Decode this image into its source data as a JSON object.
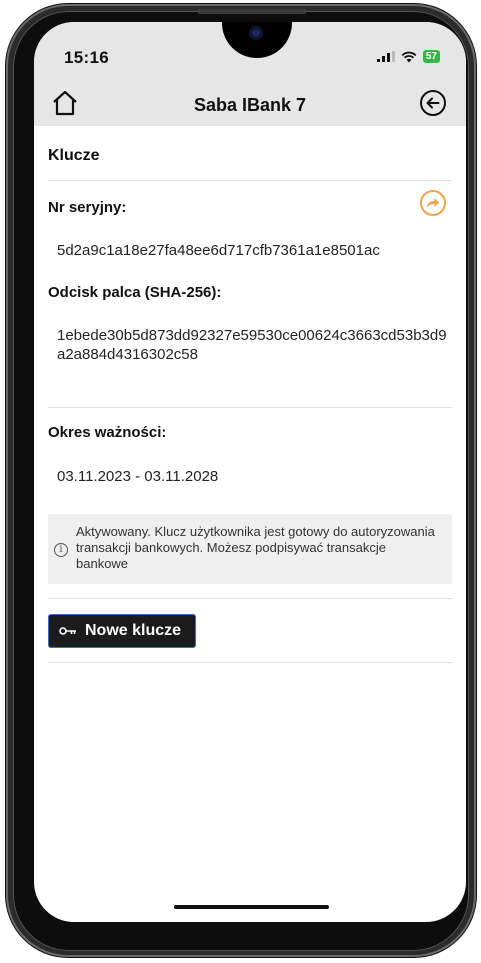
{
  "status_bar": {
    "time": "15:16",
    "battery": "57"
  },
  "app_bar": {
    "title": "Saba IBank 7",
    "home_icon": "home-icon",
    "back_icon": "back-arrow-circle-icon"
  },
  "keys": {
    "section_title": "Klucze",
    "serial_label": "Nr seryjny:",
    "serial_value": "5d2a9c1a18e27fa48ee6d717cfb7361a1e8501ac",
    "fingerprint_label": "Odcisk palca (SHA-256):",
    "fingerprint_value": "1ebede30b5d873dd92327e59530ce00624c3663cd53b3d9a2a884d4316302c58",
    "validity_label": "Okres ważności:",
    "validity_value": "03.11.2023 - 03.11.2028",
    "status_message": "Aktywowany. Klucz użytkownika jest gotowy do autoryzowania transakcji bankowych. Możesz podpisywać transakcje bankowe",
    "new_keys_button": "Nowe klucze"
  },
  "colors": {
    "accent_orange": "#f0a24c",
    "header_bg": "#e6e6e6",
    "button_bg": "#1b1b1b"
  }
}
